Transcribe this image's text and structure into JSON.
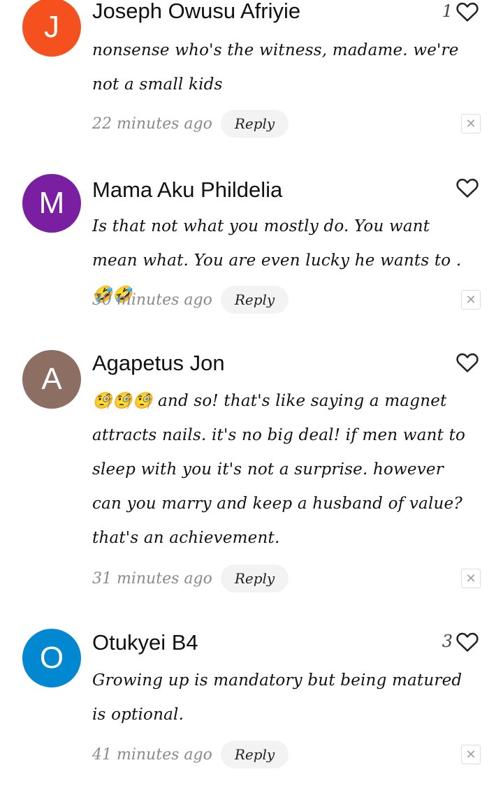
{
  "colors": {
    "avatar_j": "#F4511E",
    "avatar_m": "#7B1FA2",
    "avatar_a": "#8D6E63",
    "avatar_o": "#0288D1"
  },
  "comments": [
    {
      "initial": "J",
      "author": "Joseph Owusu Afriyie",
      "likes": "1",
      "text": "nonsense who's the witness, madame. we're not a small kids",
      "time": "22 minutes ago",
      "reply_label": "Reply"
    },
    {
      "initial": "M",
      "author": "Mama Aku Phildelia",
      "likes": "",
      "text": "Is that not what you mostly do. You want mean what. You are even lucky he wants to . 🤣🤣",
      "time": "30 minutes ago",
      "reply_label": "Reply"
    },
    {
      "initial": "A",
      "author": "Agapetus Jon",
      "likes": "",
      "text": "🧐🧐🧐 and so! that's like saying a magnet attracts nails. it's no big deal! if men want to sleep with you it's not a surprise. however can you marry and keep a husband of value? that's an achievement.",
      "time": "31 minutes ago",
      "reply_label": "Reply"
    },
    {
      "initial": "O",
      "author": "Otukyei B4",
      "likes": "3",
      "text": "Growing up is mandatory but being matured is optional.",
      "time": "41 minutes ago",
      "reply_label": "Reply"
    }
  ],
  "icons": {
    "like": "heart-outline-icon",
    "dismiss": "close-icon"
  }
}
